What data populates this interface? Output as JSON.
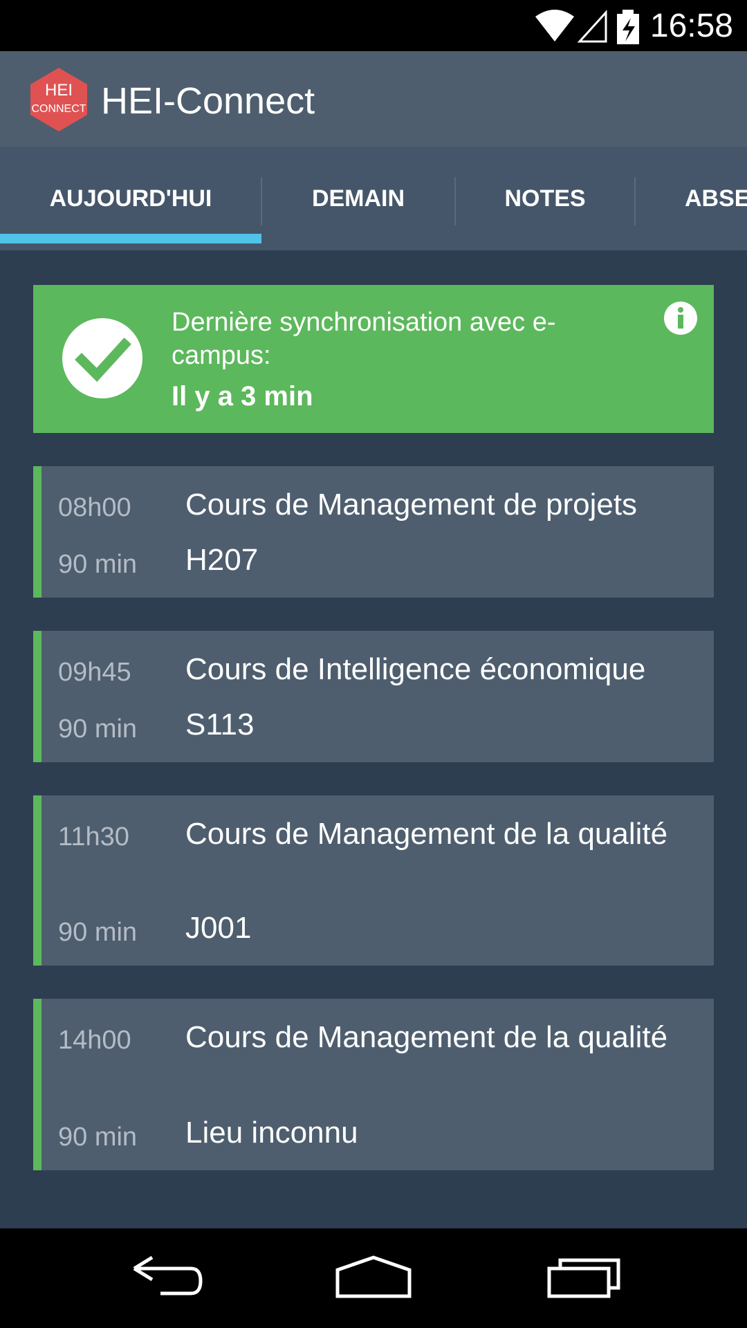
{
  "status_bar": {
    "time": "16:58",
    "icons": [
      "wifi-icon",
      "signal-icon",
      "battery-icon"
    ]
  },
  "app_bar": {
    "title": "HEI-Connect",
    "logo_line1": "HEI",
    "logo_line2": "CONNECT",
    "logo_color": "#e05252"
  },
  "tabs": [
    {
      "label": "AUJOURD'HUI",
      "selected": true
    },
    {
      "label": "DEMAIN",
      "selected": false
    },
    {
      "label": "NOTES",
      "selected": false
    },
    {
      "label": "ABSE",
      "selected": false
    }
  ],
  "sync": {
    "line1": "Dernière synchronisation avec e-campus:",
    "status": "Il y a 3 min",
    "icon": "check-circle-icon",
    "info_icon": "info-icon"
  },
  "courses": [
    {
      "time": "08h00",
      "duration": "90 min",
      "title": "Cours de Management de projets",
      "room": "H207"
    },
    {
      "time": "09h45",
      "duration": "90 min",
      "title": "Cours de Intelligence économique",
      "room": "S113"
    },
    {
      "time": "11h30",
      "duration": "90 min",
      "title": "Cours de Management de la qualité",
      "room": "J001"
    },
    {
      "time": "14h00",
      "duration": "90 min",
      "title": "Cours de Management de la qualité",
      "room": "Lieu inconnu"
    }
  ],
  "nav_bar": {
    "buttons": [
      "back-icon",
      "home-icon",
      "recents-icon"
    ]
  },
  "colors": {
    "accent": "#4fc3e8",
    "success": "#5cb85c",
    "background": "#2d3e50",
    "card": "#4e5e6e"
  }
}
